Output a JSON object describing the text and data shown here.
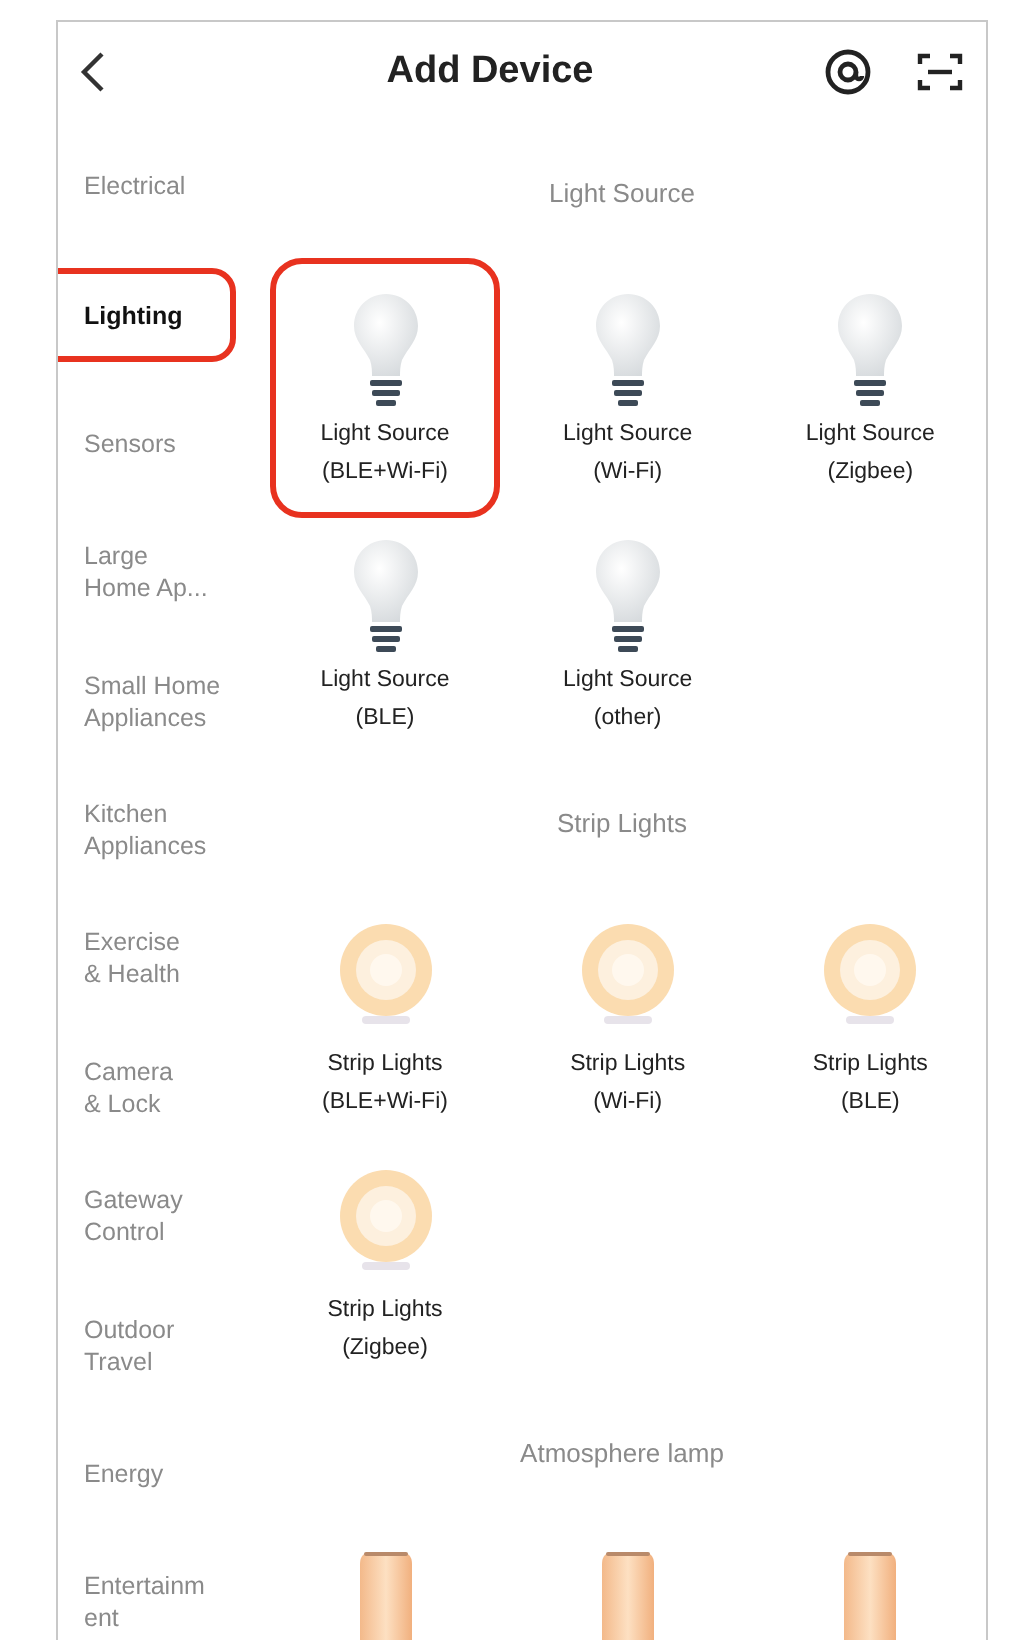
{
  "header": {
    "title": "Add Device"
  },
  "sidebar": {
    "categories": [
      {
        "label": "Electrical",
        "selected": false,
        "highlighted": false
      },
      {
        "label": "Lighting",
        "selected": true,
        "highlighted": true
      },
      {
        "label": "Sensors",
        "selected": false,
        "highlighted": false
      },
      {
        "label": "Large\nHome Ap...",
        "selected": false,
        "highlighted": false
      },
      {
        "label": "Small Home\nAppliances",
        "selected": false,
        "highlighted": false
      },
      {
        "label": "Kitchen\nAppliances",
        "selected": false,
        "highlighted": false
      },
      {
        "label": "Exercise\n& Health",
        "selected": false,
        "highlighted": false
      },
      {
        "label": "Camera\n& Lock",
        "selected": false,
        "highlighted": false
      },
      {
        "label": "Gateway\nControl",
        "selected": false,
        "highlighted": false
      },
      {
        "label": "Outdoor\nTravel",
        "selected": false,
        "highlighted": false
      },
      {
        "label": "Energy",
        "selected": false,
        "highlighted": false
      },
      {
        "label": "Entertainm\nent",
        "selected": false,
        "highlighted": false
      }
    ]
  },
  "sections": [
    {
      "title": "Light Source",
      "items": [
        {
          "kind": "bulb",
          "name": "Light Source",
          "protocol": "(BLE+Wi-Fi)",
          "highlighted": true
        },
        {
          "kind": "bulb",
          "name": "Light Source",
          "protocol": "(Wi-Fi)",
          "highlighted": false
        },
        {
          "kind": "bulb",
          "name": "Light Source",
          "protocol": "(Zigbee)",
          "highlighted": false
        },
        {
          "kind": "bulb",
          "name": "Light Source",
          "protocol": "(BLE)",
          "highlighted": false
        },
        {
          "kind": "bulb",
          "name": "Light Source",
          "protocol": "(other)",
          "highlighted": false
        }
      ]
    },
    {
      "title": "Strip Lights",
      "items": [
        {
          "kind": "strip",
          "name": "Strip Lights",
          "protocol": "(BLE+Wi-Fi)",
          "highlighted": false
        },
        {
          "kind": "strip",
          "name": "Strip Lights",
          "protocol": "(Wi-Fi)",
          "highlighted": false
        },
        {
          "kind": "strip",
          "name": "Strip Lights",
          "protocol": "(BLE)",
          "highlighted": false
        },
        {
          "kind": "strip",
          "name": "Strip Lights",
          "protocol": "(Zigbee)",
          "highlighted": false
        }
      ]
    },
    {
      "title": "Atmosphere lamp",
      "items": [
        {
          "kind": "lamp",
          "highlighted": false
        },
        {
          "kind": "lamp",
          "highlighted": false
        },
        {
          "kind": "lamp",
          "highlighted": false
        }
      ]
    }
  ]
}
